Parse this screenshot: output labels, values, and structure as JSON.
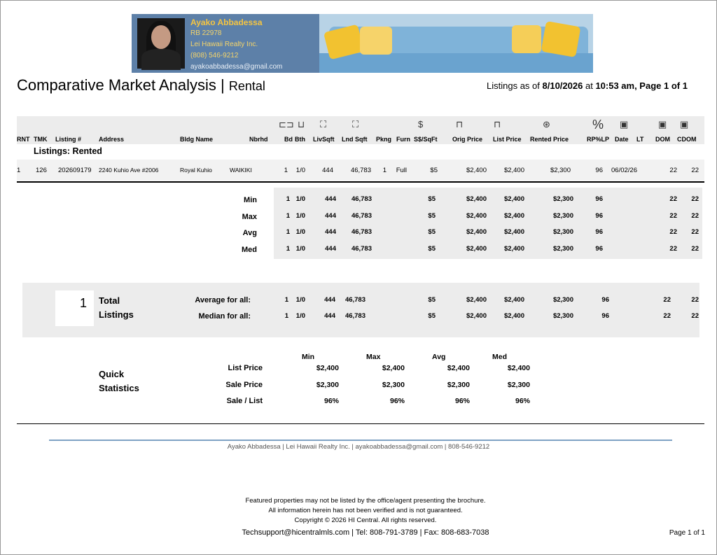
{
  "agent": {
    "name": "Ayako Abbadessa",
    "license": "RB 22978",
    "company": "Lei Hawaii Realty Inc.",
    "phone": "(808) 546-9212",
    "email": "ayakoabbadessa@gmail.com"
  },
  "report": {
    "title": "Comparative Market Analysis",
    "separator": "|",
    "subtitle": "Rental",
    "asof_prefix": "Listings as of",
    "asof_date": "8/10/2026",
    "asof_at": "at",
    "asof_time": "10:53 am, Page 1 of 1"
  },
  "columns": [
    "RNT",
    "TMK",
    "Listing #",
    "Address",
    "Bldg Name",
    "Nbrhd",
    "Bd",
    "Bth",
    "LivSqft",
    "Lnd Sqft",
    "Pkng",
    "Furn",
    "S$/SqFt",
    "Orig Price",
    "List Price",
    "Rented Price",
    "RP%LP",
    "Date",
    "LT",
    "DOM",
    "CDOM"
  ],
  "section_label": "Listings: Rented",
  "row": [
    "1",
    "126",
    "202609179",
    "2240 Kuhio Ave #2006",
    "Royal Kuhio",
    "WAIKIKI",
    "1",
    "1/0",
    "444",
    "46,783",
    "1",
    "Full",
    "$5",
    "$2,400",
    "$2,400",
    "$2,300",
    "96",
    "06/02/26",
    "",
    "22",
    "22"
  ],
  "stats": [
    {
      "label": "Min",
      "bd": "1",
      "bth": "1/0",
      "liv": "444",
      "lnd": "46,783",
      "psf": "$5",
      "orig": "$2,400",
      "list": "$2,400",
      "rented": "$2,300",
      "pct": "96",
      "dom": "22",
      "cdom": "22"
    },
    {
      "label": "Max",
      "bd": "1",
      "bth": "1/0",
      "liv": "444",
      "lnd": "46,783",
      "psf": "$5",
      "orig": "$2,400",
      "list": "$2,400",
      "rented": "$2,300",
      "pct": "96",
      "dom": "22",
      "cdom": "22"
    },
    {
      "label": "Avg",
      "bd": "1",
      "bth": "1/0",
      "liv": "444",
      "lnd": "46,783",
      "psf": "$5",
      "orig": "$2,400",
      "list": "$2,400",
      "rented": "$2,300",
      "pct": "96",
      "dom": "22",
      "cdom": "22"
    },
    {
      "label": "Med",
      "bd": "1",
      "bth": "1/0",
      "liv": "444",
      "lnd": "46,783",
      "psf": "$5",
      "orig": "$2,400",
      "list": "$2,400",
      "rented": "$2,300",
      "pct": "96",
      "dom": "22",
      "cdom": "22"
    }
  ],
  "totals": {
    "count": "1",
    "label1": "Total",
    "label2": "Listings",
    "rows": [
      {
        "label": "Average for all:",
        "bd": "1",
        "bth": "1/0",
        "liv": "444",
        "lnd": "46,783",
        "psf": "$5",
        "orig": "$2,400",
        "list": "$2,400",
        "rented": "$2,300",
        "pct": "96",
        "dom": "22",
        "cdom": "22"
      },
      {
        "label": "Median for all:",
        "bd": "1",
        "bth": "1/0",
        "liv": "444",
        "lnd": "46,783",
        "psf": "$5",
        "orig": "$2,400",
        "list": "$2,400",
        "rented": "$2,300",
        "pct": "96",
        "dom": "22",
        "cdom": "22"
      }
    ]
  },
  "quick": {
    "label1": "Quick",
    "label2": "Statistics",
    "headers": [
      "Min",
      "Max",
      "Avg",
      "Med"
    ],
    "rows": [
      {
        "label": "List Price",
        "values": [
          "$2,400",
          "$2,400",
          "$2,400",
          "$2,400"
        ]
      },
      {
        "label": "Sale Price",
        "values": [
          "$2,300",
          "$2,300",
          "$2,300",
          "$2,300"
        ]
      },
      {
        "label": "Sale / List",
        "values": [
          "96%",
          "96%",
          "96%",
          "96%"
        ]
      }
    ]
  },
  "footer": {
    "agent_line": "Ayako Abbadessa | Lei Hawaii Realty Inc. | ayakoabbadessa@gmail.com | 808-546-9212",
    "disclaimer1": "Featured properties may not be listed by the office/agent presenting the brochure.",
    "disclaimer2": "All information herein has not been verified and is not guaranteed.",
    "copyright": "Copyright © 2026 HI Central. All rights reserved.",
    "contact": "Techsupport@hicentralmls.com | Tel: 808-791-3789 | Fax: 808-683-7038",
    "page": "Page 1 of 1"
  },
  "icons": [
    "bed-icon",
    "bath-icon",
    "area-icon",
    "lot-area-icon",
    "dollar-box-icon",
    "price-tag-icon",
    "price-tag-icon",
    "dollar-circle-icon",
    "percent-icon",
    "calendar-icon",
    "calendar-icon",
    "calendar-icon"
  ],
  "colors": {
    "banner": "#5d80a8",
    "agent_name": "#f5c542",
    "rule": "#7fa2c4"
  }
}
